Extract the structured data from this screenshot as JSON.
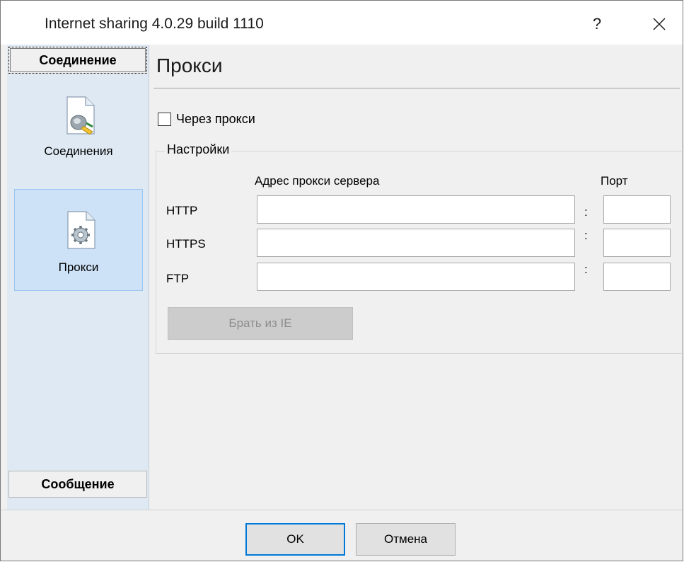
{
  "window": {
    "title": "Internet sharing 4.0.29 build 1110",
    "help_label": "?"
  },
  "sidebar": {
    "groups": [
      {
        "label": "Соединение"
      },
      {
        "label": "Сообщение"
      }
    ],
    "items": [
      {
        "label": "Соединения",
        "icon": "connection-plug-icon"
      },
      {
        "label": "Прокси",
        "icon": "proxy-settings-gear-icon"
      }
    ]
  },
  "page": {
    "title": "Прокси",
    "use_proxy_label": "Через прокси",
    "use_proxy_checked": false,
    "settings_group": {
      "legend": "Настройки",
      "address_header": "Адрес прокси сервера",
      "port_header": "Порт",
      "rows": [
        {
          "label": "HTTP",
          "address": "",
          "port": ""
        },
        {
          "label": "HTTPS",
          "address": "",
          "port": ""
        },
        {
          "label": "FTP",
          "address": "",
          "port": ""
        }
      ],
      "colon": ":",
      "import_button": "Брать из IE"
    }
  },
  "footer": {
    "ok_label": "OK",
    "cancel_label": "Отмена"
  },
  "colors": {
    "accent": "#0078d7",
    "sidebar_bg": "#dfe9f3",
    "selected_bg": "#cde2f7"
  }
}
